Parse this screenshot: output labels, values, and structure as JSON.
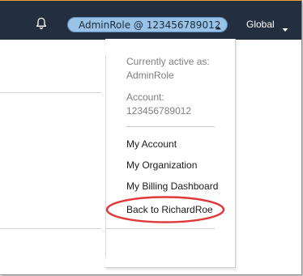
{
  "navbar": {
    "role_label": "AdminRole @ 123456789012",
    "region_label": "Global"
  },
  "dropdown": {
    "active_as_label": "Currently active as:",
    "active_role": "AdminRole",
    "account_label": "Account:",
    "account_id": "123456789012",
    "items": [
      {
        "label": "My Account"
      },
      {
        "label": "My Organization"
      },
      {
        "label": "My Billing Dashboard"
      },
      {
        "label": "Back to RichardRoe"
      }
    ]
  },
  "colors": {
    "navbar_bg": "#232f3e",
    "role_pill_bg": "#99c2e6",
    "highlight_ring": "#e0393a"
  },
  "icons": {
    "bell": "bell-icon",
    "role_caret": "caret-up-icon",
    "region_caret": "caret-down-icon"
  }
}
